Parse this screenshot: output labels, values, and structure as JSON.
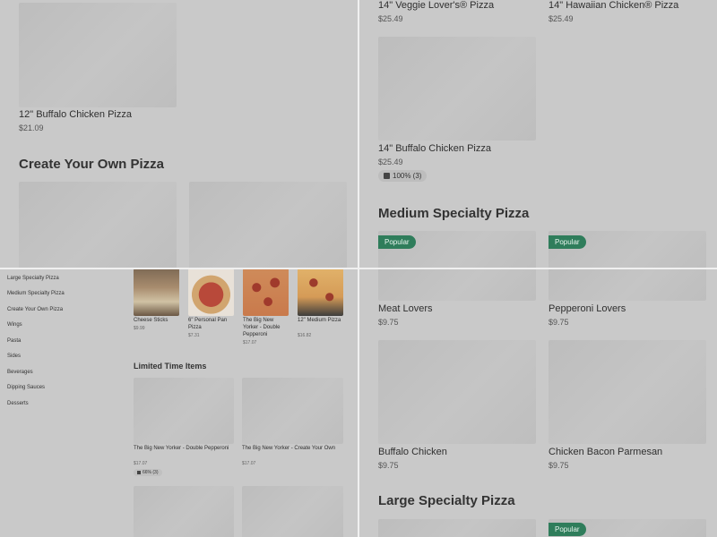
{
  "top_left": {
    "item": {
      "name": "12\" Buffalo Chicken Pizza",
      "price": "$21.09"
    },
    "section_title": "Create Your Own Pizza"
  },
  "top_right": {
    "items": [
      {
        "name": "14\" Veggie Lover's® Pizza",
        "price": "$25.49"
      },
      {
        "name": "14\" Hawaiian Chicken® Pizza",
        "price": "$25.49"
      },
      {
        "name": "14\" Buffalo Chicken Pizza",
        "price": "$25.49",
        "rating": "100% (3)"
      }
    ],
    "section_title": "Medium Specialty Pizza",
    "badges": [
      "Popular",
      "Popular"
    ]
  },
  "bottom_left": {
    "sidebar": [
      "Large Specialty Pizza",
      "Medium Specialty Pizza",
      "Create Your Own Pizza",
      "Wings",
      "Pasta",
      "Sides",
      "Beverages",
      "Dipping Sauces",
      "Desserts"
    ],
    "featured": [
      {
        "name": "Cheese Sticks",
        "price": "$9.99"
      },
      {
        "name": "6\" Personal Pan Pizza",
        "price": "$7.31"
      },
      {
        "name": "The Big New Yorker - Double Pepperoni",
        "price": "$17.07"
      },
      {
        "name": "12\" Medium Pizza",
        "price": "$16.82"
      }
    ],
    "section_title": "Limited Time Items",
    "limited": [
      {
        "name": "The Big New Yorker - Double Pepperoni",
        "price": "$17.07",
        "rating": "66% (3)"
      },
      {
        "name": "The Big New Yorker - Create Your Own",
        "price": "$17.07"
      }
    ]
  },
  "bottom_right": {
    "items": [
      {
        "name": "Meat Lovers",
        "price": "$9.75"
      },
      {
        "name": "Pepperoni Lovers",
        "price": "$9.75"
      },
      {
        "name": "Buffalo Chicken",
        "price": "$9.75"
      },
      {
        "name": "Chicken Bacon Parmesan",
        "price": "$9.75"
      }
    ],
    "section_title": "Large Specialty Pizza",
    "badge": "Popular"
  },
  "colors": {
    "badge_bg": "#2f7d5b",
    "overlay": "#c9c9c9",
    "divider": "#f0f0f0"
  }
}
